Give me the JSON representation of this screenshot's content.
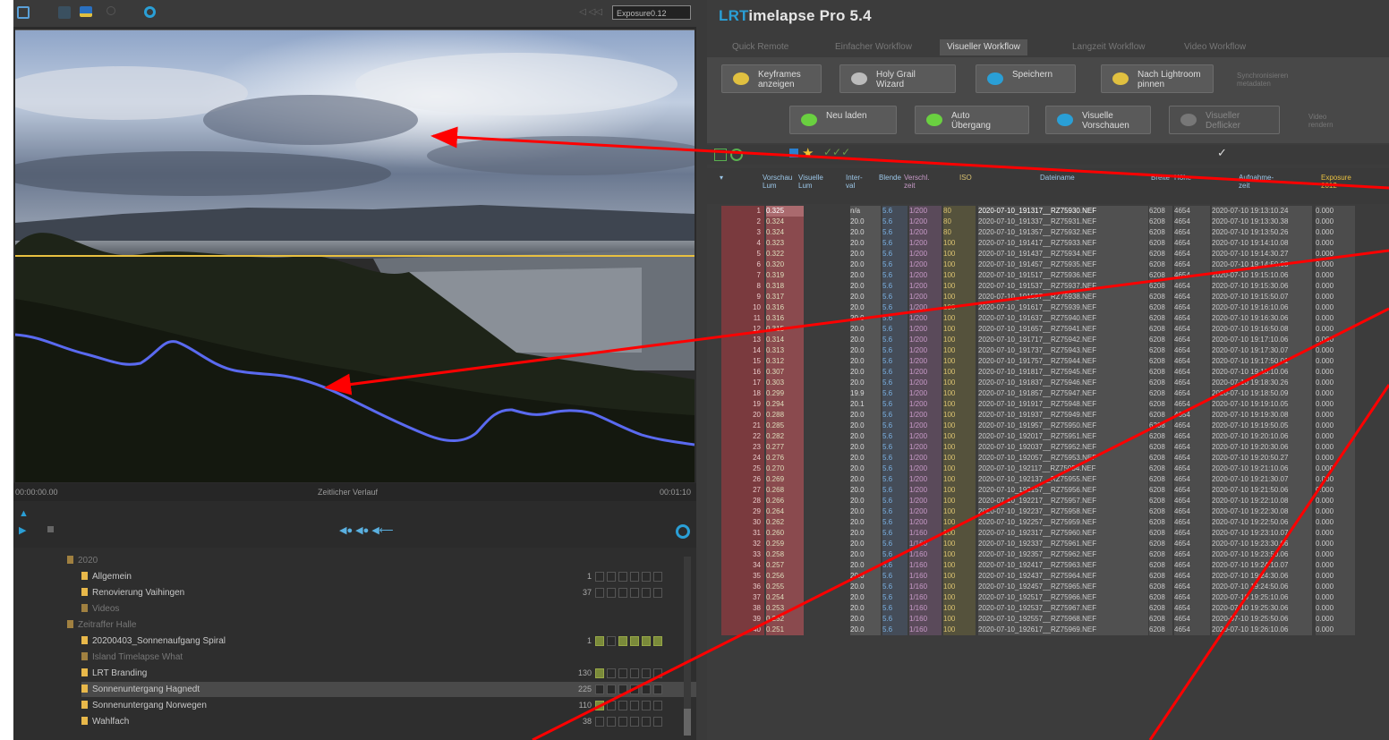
{
  "left": {
    "preview_label": "Exposure0.12",
    "timeline": {
      "start": "00:00:00.00",
      "mid": "Zeitlicher Verlauf",
      "end": "00:01:10"
    },
    "tree": {
      "items": [
        {
          "label": "2020",
          "dim": true,
          "indent": 1,
          "count": "",
          "cells": ""
        },
        {
          "label": "Allgemein",
          "dim": false,
          "indent": 2,
          "count": "1",
          "cells": "000000"
        },
        {
          "label": "Renovierung Vaihingen",
          "dim": false,
          "indent": 2,
          "count": "37",
          "cells": "000000"
        },
        {
          "label": "Videos",
          "dim": true,
          "indent": 2,
          "count": "",
          "cells": ""
        },
        {
          "label": "Zeitraffer Halle",
          "dim": true,
          "indent": 1,
          "count": "",
          "cells": ""
        },
        {
          "label": "20200403_Sonnenaufgang Spiral",
          "dim": false,
          "indent": 2,
          "count": "1",
          "cells": "101111"
        },
        {
          "label": "Island Timelapse What",
          "dim": true,
          "indent": 2,
          "count": "",
          "cells": ""
        },
        {
          "label": "LRT Branding",
          "dim": false,
          "indent": 2,
          "count": "130",
          "cells": "100000"
        },
        {
          "label": "Sonnenuntergang Hagnedt",
          "dim": false,
          "indent": 2,
          "count": "225",
          "cells": "000000",
          "selected": true
        },
        {
          "label": "Sonnenuntergang Norwegen",
          "dim": false,
          "indent": 2,
          "count": "110",
          "cells": "100000"
        },
        {
          "label": "Wahlfach",
          "dim": false,
          "indent": 2,
          "count": "38",
          "cells": "000000"
        }
      ]
    }
  },
  "right": {
    "title_prefix": "LRT",
    "title_rest": "imelapse Pro 5.4",
    "tabs": [
      "Quick Remote",
      "Einfacher Workflow",
      "Visueller Workflow",
      "Langzeit Workflow",
      "Video Workflow"
    ],
    "active_tab": 2,
    "workflow": {
      "row1": [
        {
          "label": "Keyframes\nanzeigen",
          "icon": "keyframe-wand-icon"
        },
        {
          "label": "Holy Grail\nWizard",
          "icon": "scissors-icon"
        },
        {
          "label": "Speichern",
          "icon": "save-cloud-icon"
        },
        {
          "label": "Nach Lightroom\npinnen",
          "icon": "lightroom-pin-icon"
        }
      ],
      "row1_note": "Synchronisieren\nmetadaten",
      "row2": [
        {
          "label": "Neu laden",
          "icon": "reload-icon"
        },
        {
          "label": "Auto\nÜbergang",
          "icon": "transition-curve-icon"
        },
        {
          "label": "Visuelle\nVorschauen",
          "icon": "visual-preview-icon"
        },
        {
          "label": "Visueller\nDeflicker",
          "icon": "deflicker-icon",
          "dim": true
        }
      ],
      "row2_note": "Video\nrendern"
    },
    "table": {
      "headers": [
        "Vorschau\nLum",
        "Visuelle\nLum",
        "Inter-\nval",
        "Blende",
        "Verschl.\nzeit",
        "ISO",
        "Dateiname",
        "Breite",
        "Höhe",
        "Aufnahme-\nzeit",
        "Exposure\n2012"
      ],
      "rows": [
        [
          "1",
          "0.325",
          "n/a",
          "5.6",
          "1/200",
          "80",
          "2020-07-10_191317__RZ75930.NEF",
          "6208",
          "4654",
          "2020-07-10 19:13:10.24",
          "0.000"
        ],
        [
          "2",
          "0.324",
          "20.0",
          "5.6",
          "1/200",
          "80",
          "2020-07-10_191337__RZ75931.NEF",
          "6208",
          "4654",
          "2020-07-10 19:13:30.38",
          "0.000"
        ],
        [
          "3",
          "0.324",
          "20.0",
          "5.6",
          "1/200",
          "80",
          "2020-07-10_191357__RZ75932.NEF",
          "6208",
          "4654",
          "2020-07-10 19:13:50.26",
          "0.000"
        ],
        [
          "4",
          "0.323",
          "20.0",
          "5.6",
          "1/200",
          "100",
          "2020-07-10_191417__RZ75933.NEF",
          "6208",
          "4654",
          "2020-07-10 19:14:10.08",
          "0.000"
        ],
        [
          "5",
          "0.322",
          "20.0",
          "5.6",
          "1/200",
          "100",
          "2020-07-10_191437__RZ75934.NEF",
          "6208",
          "4654",
          "2020-07-10 19:14:30.27",
          "0.000"
        ],
        [
          "6",
          "0.320",
          "20.0",
          "5.6",
          "1/200",
          "100",
          "2020-07-10_191457__RZ75935.NEF",
          "6208",
          "4654",
          "2020-07-10 19:14:50.08",
          "0.000"
        ],
        [
          "7",
          "0.319",
          "20.0",
          "5.6",
          "1/200",
          "100",
          "2020-07-10_191517__RZ75936.NEF",
          "6208",
          "4654",
          "2020-07-10 19:15:10.06",
          "0.000"
        ],
        [
          "8",
          "0.318",
          "20.0",
          "5.6",
          "1/200",
          "100",
          "2020-07-10_191537__RZ75937.NEF",
          "6208",
          "4654",
          "2020-07-10 19:15:30.06",
          "0.000"
        ],
        [
          "9",
          "0.317",
          "20.0",
          "5.6",
          "1/200",
          "100",
          "2020-07-10_191557__RZ75938.NEF",
          "6208",
          "4654",
          "2020-07-10 19:15:50.07",
          "0.000"
        ],
        [
          "10",
          "0.316",
          "20.0",
          "5.6",
          "1/200",
          "100",
          "2020-07-10_191617__RZ75939.NEF",
          "6208",
          "4654",
          "2020-07-10 19:16:10.06",
          "0.000"
        ],
        [
          "11",
          "0.316",
          "20.0",
          "5.6",
          "1/200",
          "100",
          "2020-07-10_191637__RZ75940.NEF",
          "6208",
          "4654",
          "2020-07-10 19:16:30.06",
          "0.000"
        ],
        [
          "12",
          "0.315",
          "20.0",
          "5.6",
          "1/200",
          "100",
          "2020-07-10_191657__RZ75941.NEF",
          "6208",
          "4654",
          "2020-07-10 19:16:50.08",
          "0.000"
        ],
        [
          "13",
          "0.314",
          "20.0",
          "5.6",
          "1/200",
          "100",
          "2020-07-10_191717__RZ75942.NEF",
          "6208",
          "4654",
          "2020-07-10 19:17:10.06",
          "0.000"
        ],
        [
          "14",
          "0.313",
          "20.0",
          "5.6",
          "1/200",
          "100",
          "2020-07-10_191737__RZ75943.NEF",
          "6208",
          "4654",
          "2020-07-10 19:17:30.07",
          "0.000"
        ],
        [
          "15",
          "0.312",
          "20.0",
          "5.6",
          "1/200",
          "100",
          "2020-07-10_191757__RZ75944.NEF",
          "6208",
          "4654",
          "2020-07-10 19:17:50.01",
          "0.000"
        ],
        [
          "16",
          "0.307",
          "20.0",
          "5.6",
          "1/200",
          "100",
          "2020-07-10_191817__RZ75945.NEF",
          "6208",
          "4654",
          "2020-07-10 19:18:10.06",
          "0.000"
        ],
        [
          "17",
          "0.303",
          "20.0",
          "5.6",
          "1/200",
          "100",
          "2020-07-10_191837__RZ75946.NEF",
          "6208",
          "4654",
          "2020-07-10 19:18:30.26",
          "0.000"
        ],
        [
          "18",
          "0.299",
          "19.9",
          "5.6",
          "1/200",
          "100",
          "2020-07-10_191857__RZ75947.NEF",
          "6208",
          "4654",
          "2020-07-10 19:18:50.09",
          "0.000"
        ],
        [
          "19",
          "0.294",
          "20.1",
          "5.6",
          "1/200",
          "100",
          "2020-07-10_191917__RZ75948.NEF",
          "6208",
          "4654",
          "2020-07-10 19:19:10.05",
          "0.000"
        ],
        [
          "20",
          "0.288",
          "20.0",
          "5.6",
          "1/200",
          "100",
          "2020-07-10_191937__RZ75949.NEF",
          "6208",
          "4654",
          "2020-07-10 19:19:30.08",
          "0.000"
        ],
        [
          "21",
          "0.285",
          "20.0",
          "5.6",
          "1/200",
          "100",
          "2020-07-10_191957__RZ75950.NEF",
          "6208",
          "4654",
          "2020-07-10 19:19:50.05",
          "0.000"
        ],
        [
          "22",
          "0.282",
          "20.0",
          "5.6",
          "1/200",
          "100",
          "2020-07-10_192017__RZ75951.NEF",
          "6208",
          "4654",
          "2020-07-10 19:20:10.06",
          "0.000"
        ],
        [
          "23",
          "0.277",
          "20.0",
          "5.6",
          "1/200",
          "100",
          "2020-07-10_192037__RZ75952.NEF",
          "6208",
          "4654",
          "2020-07-10 19:20:30.06",
          "0.000"
        ],
        [
          "24",
          "0.276",
          "20.0",
          "5.6",
          "1/200",
          "100",
          "2020-07-10_192057__RZ75953.NEF",
          "6208",
          "4654",
          "2020-07-10 19:20:50.27",
          "0.000"
        ],
        [
          "25",
          "0.270",
          "20.0",
          "5.6",
          "1/200",
          "100",
          "2020-07-10_192117__RZ75954.NEF",
          "6208",
          "4654",
          "2020-07-10 19:21:10.06",
          "0.000"
        ],
        [
          "26",
          "0.269",
          "20.0",
          "5.6",
          "1/200",
          "100",
          "2020-07-10_192137__RZ75955.NEF",
          "6208",
          "4654",
          "2020-07-10 19:21:30.07",
          "0.000"
        ],
        [
          "27",
          "0.268",
          "20.0",
          "5.6",
          "1/200",
          "100",
          "2020-07-10_192157__RZ75956.NEF",
          "6208",
          "4654",
          "2020-07-10 19:21:50.06",
          "0.000"
        ],
        [
          "28",
          "0.266",
          "20.0",
          "5.6",
          "1/200",
          "100",
          "2020-07-10_192217__RZ75957.NEF",
          "6208",
          "4654",
          "2020-07-10 19:22:10.08",
          "0.000"
        ],
        [
          "29",
          "0.264",
          "20.0",
          "5.6",
          "1/200",
          "100",
          "2020-07-10_192237__RZ75958.NEF",
          "6208",
          "4654",
          "2020-07-10 19:22:30.08",
          "0.000"
        ],
        [
          "30",
          "0.262",
          "20.0",
          "5.6",
          "1/200",
          "100",
          "2020-07-10_192257__RZ75959.NEF",
          "6208",
          "4654",
          "2020-07-10 19:22:50.06",
          "0.000"
        ],
        [
          "31",
          "0.260",
          "20.0",
          "5.6",
          "1/160",
          "100",
          "2020-07-10_192317__RZ75960.NEF",
          "6208",
          "4654",
          "2020-07-10 19:23:10.07",
          "0.000"
        ],
        [
          "32",
          "0.259",
          "20.0",
          "5.6",
          "1/160",
          "100",
          "2020-07-10_192337__RZ75961.NEF",
          "6208",
          "4654",
          "2020-07-10 19:23:30.06",
          "0.000"
        ],
        [
          "33",
          "0.258",
          "20.0",
          "5.6",
          "1/160",
          "100",
          "2020-07-10_192357__RZ75962.NEF",
          "6208",
          "4654",
          "2020-07-10 19:23:50.06",
          "0.000"
        ],
        [
          "34",
          "0.257",
          "20.0",
          "5.6",
          "1/160",
          "100",
          "2020-07-10_192417__RZ75963.NEF",
          "6208",
          "4654",
          "2020-07-10 19:24:10.07",
          "0.000"
        ],
        [
          "35",
          "0.256",
          "20.0",
          "5.6",
          "1/160",
          "100",
          "2020-07-10_192437__RZ75964.NEF",
          "6208",
          "4654",
          "2020-07-10 19:24:30.06",
          "0.000"
        ],
        [
          "36",
          "0.255",
          "20.0",
          "5.6",
          "1/160",
          "100",
          "2020-07-10_192457__RZ75965.NEF",
          "6208",
          "4654",
          "2020-07-10 19:24:50.06",
          "0.000"
        ],
        [
          "37",
          "0.254",
          "20.0",
          "5.6",
          "1/160",
          "100",
          "2020-07-10_192517__RZ75966.NEF",
          "6208",
          "4654",
          "2020-07-10 19:25:10.06",
          "0.000"
        ],
        [
          "38",
          "0.253",
          "20.0",
          "5.6",
          "1/160",
          "100",
          "2020-07-10_192537__RZ75967.NEF",
          "6208",
          "4654",
          "2020-07-10 19:25:30.06",
          "0.000"
        ],
        [
          "39",
          "0.252",
          "20.0",
          "5.6",
          "1/160",
          "100",
          "2020-07-10_192557__RZ75968.NEF",
          "6208",
          "4654",
          "2020-07-10 19:25:50.06",
          "0.000"
        ],
        [
          "40",
          "0.251",
          "20.0",
          "5.6",
          "1/160",
          "100",
          "2020-07-10_192617__RZ75969.NEF",
          "6208",
          "4654",
          "2020-07-10 19:26:10.06",
          "0.000"
        ]
      ]
    }
  },
  "colors": {
    "luminance_curve": "#5a6af0",
    "horizon_line": "#e8c040",
    "annotation_arrow": "#ff0000",
    "title_accent": "#2a9fd6"
  }
}
